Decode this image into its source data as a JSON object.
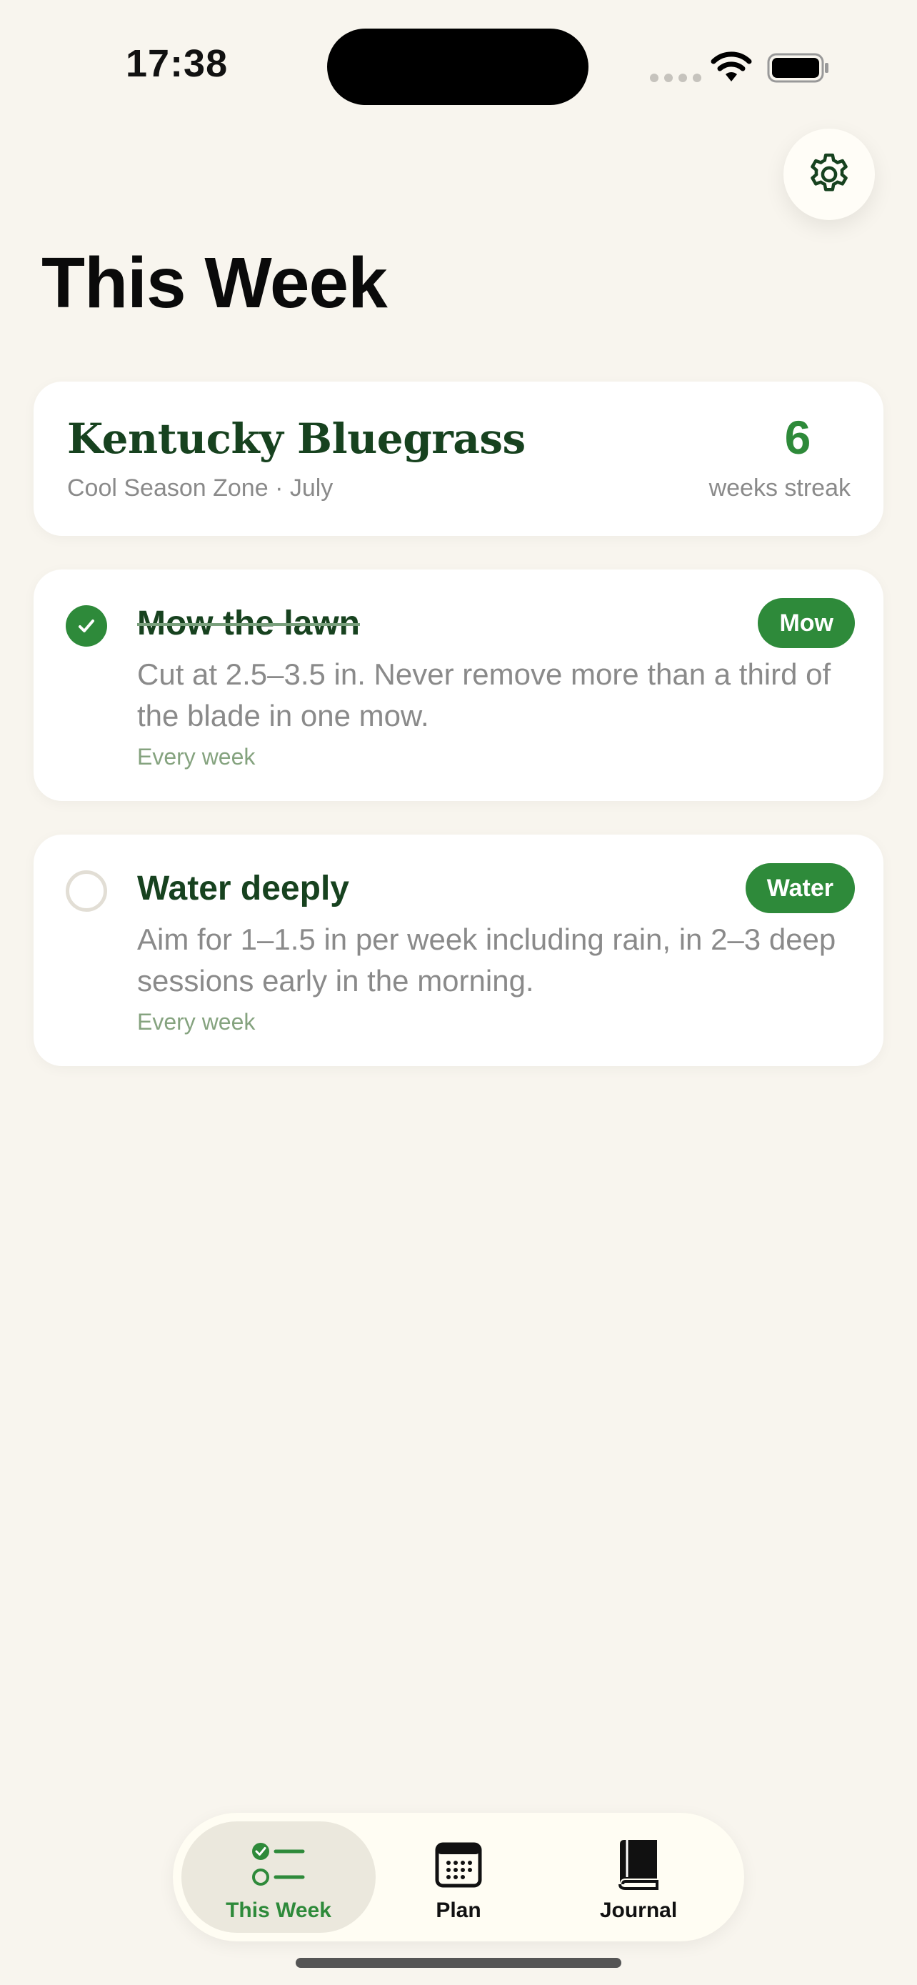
{
  "status_bar": {
    "time": "17:38"
  },
  "header": {
    "title": "This Week"
  },
  "grass_card": {
    "name": "Kentucky Bluegrass",
    "subtitle": "Cool Season Zone · July",
    "streak_value": "6",
    "streak_label": "weeks streak"
  },
  "tasks": [
    {
      "title": "Mow the lawn",
      "description": "Cut at 2.5–3.5 in. Never remove more than a third of the blade in one mow.",
      "frequency": "Every week",
      "tag": "Mow",
      "completed": true
    },
    {
      "title": "Water deeply",
      "description": "Aim for 1–1.5 in per week including rain, in 2–3 deep sessions early in the morning.",
      "frequency": "Every week",
      "tag": "Water",
      "completed": false
    }
  ],
  "tab_bar": {
    "tabs": [
      {
        "label": "This Week",
        "icon": "checklist-icon",
        "active": true
      },
      {
        "label": "Plan",
        "icon": "calendar-icon",
        "active": false
      },
      {
        "label": "Journal",
        "icon": "book-icon",
        "active": false
      }
    ]
  },
  "colors": {
    "background": "#f8f5ee",
    "accent": "#2e8a3a",
    "title_green": "#17421f",
    "muted_text": "#8a8a8a"
  }
}
